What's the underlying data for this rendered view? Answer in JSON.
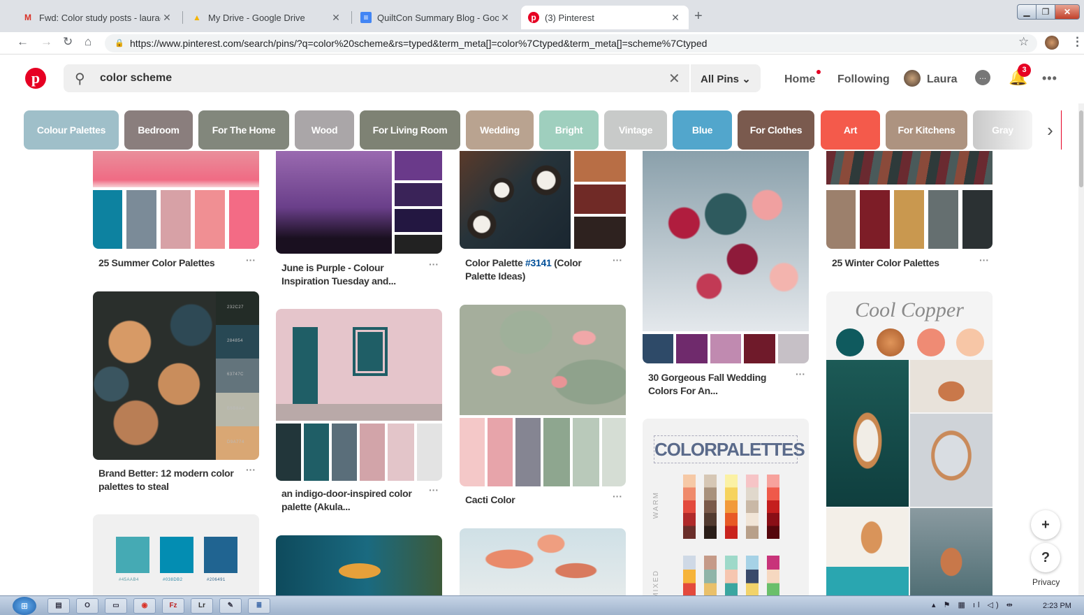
{
  "browser": {
    "tabs": [
      {
        "label": "Fwd: Color study posts - laura@h",
        "icon": "gmail-icon",
        "glyph": "M",
        "color": "#d93025"
      },
      {
        "label": "My Drive - Google Drive",
        "icon": "google-drive-icon",
        "glyph": "▲",
        "color": "#f4b400"
      },
      {
        "label": "QuiltCon Summary Blog - Googl",
        "icon": "google-docs-icon",
        "glyph": "≡",
        "color": "#4285f4"
      },
      {
        "label": "(3) Pinterest",
        "icon": "pinterest-icon",
        "glyph": "p",
        "color": "#e60023"
      }
    ],
    "url": "https://www.pinterest.com/search/pins/?q=color%20scheme&rs=typed&term_meta[]=color%7Ctyped&term_meta[]=scheme%7Ctyped"
  },
  "header": {
    "search_value": "color scheme",
    "filter": "All Pins",
    "home": "Home",
    "following": "Following",
    "user": "Laura",
    "notification_count": "3"
  },
  "guides": [
    {
      "label": "Colour Palettes",
      "color": "#9fbfc9"
    },
    {
      "label": "Bedroom",
      "color": "#8a7e7d"
    },
    {
      "label": "For The Home",
      "color": "#82877c"
    },
    {
      "label": "Wood",
      "color": "#aaa6a8"
    },
    {
      "label": "For Living Room",
      "color": "#7e8274"
    },
    {
      "label": "Wedding",
      "color": "#b9a390"
    },
    {
      "label": "Bright",
      "color": "#9fcfbe"
    },
    {
      "label": "Vintage",
      "color": "#c8cac9"
    },
    {
      "label": "Blue",
      "color": "#52a6cc"
    },
    {
      "label": "For Clothes",
      "color": "#7a5a4e"
    },
    {
      "label": "Art",
      "color": "#f45a4b"
    },
    {
      "label": "For Kitchens",
      "color": "#ad9380"
    },
    {
      "label": "Gray",
      "color": "#d0d0d0"
    }
  ],
  "pins": {
    "summer": {
      "title": "25 Summer Color Palettes"
    },
    "purple": {
      "title": "June is Purple - Colour Inspiration Tuesday and..."
    },
    "palette3141": {
      "title_pre": "Color Palette ",
      "title_link": "#3141",
      "title_post": " (Color Palette Ideas)"
    },
    "fall": {
      "title": "30 Gorgeous Fall Wedding Colors For An..."
    },
    "winter": {
      "title": "25 Winter Color Palettes"
    },
    "brand": {
      "title": "Brand Better: 12 modern color palettes to steal",
      "codes": [
        "232C27",
        "284854",
        "63747C",
        "B8B8AA",
        "D9A774"
      ]
    },
    "indigo": {
      "title": "an indigo-door-inspired color palette (Akula..."
    },
    "cacti": {
      "title": "Cacti Color"
    },
    "teal": {
      "codes": [
        "#45AAB4",
        "#038DB2",
        "#206491"
      ]
    },
    "colorpalettes": {
      "heading": "COLORPALETTES",
      "warm": "WARM",
      "mixed": "MIXED"
    },
    "copper": {
      "heading": "Cool Copper"
    }
  },
  "side": {
    "add": "+",
    "help": "?",
    "privacy": "Privacy"
  },
  "taskbar": {
    "clock": "2:23 PM"
  }
}
